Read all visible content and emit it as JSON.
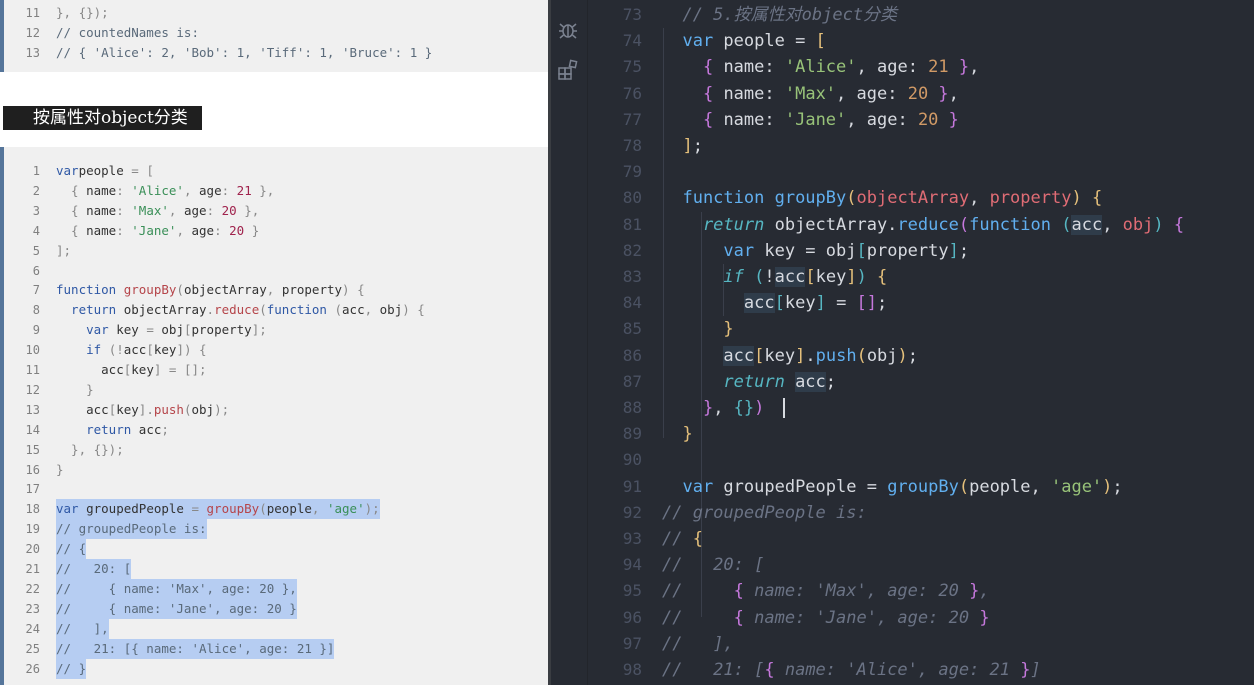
{
  "doc": {
    "heading": "按属性对object分类",
    "top_block": [
      {
        "n": "11",
        "tokens": [
          [
            "punc",
            "}, {});"
          ]
        ]
      },
      {
        "n": "12",
        "tokens": [
          [
            "cmt",
            "// countedNames is:"
          ]
        ]
      },
      {
        "n": "13",
        "tokens": [
          [
            "cmt",
            "// { 'Alice': 2, 'Bob': 1, 'Tiff': 1, 'Bruce': 1 }"
          ]
        ]
      }
    ],
    "main_block": [
      {
        "n": "1",
        "tokens": [
          [
            "kw",
            "var"
          ],
          [
            "",
            "people "
          ],
          [
            "punc",
            "= ["
          ]
        ]
      },
      {
        "n": "2",
        "tokens": [
          [
            "punc",
            "  { "
          ],
          [
            "",
            "name"
          ],
          [
            "punc",
            ": "
          ],
          [
            "str",
            "'Alice'"
          ],
          [
            "punc",
            ", "
          ],
          [
            "",
            "age"
          ],
          [
            "punc",
            ": "
          ],
          [
            "num",
            "21"
          ],
          [
            "punc",
            " },"
          ]
        ]
      },
      {
        "n": "3",
        "tokens": [
          [
            "punc",
            "  { "
          ],
          [
            "",
            "name"
          ],
          [
            "punc",
            ": "
          ],
          [
            "str",
            "'Max'"
          ],
          [
            "punc",
            ", "
          ],
          [
            "",
            "age"
          ],
          [
            "punc",
            ": "
          ],
          [
            "num",
            "20"
          ],
          [
            "punc",
            " },"
          ]
        ]
      },
      {
        "n": "4",
        "tokens": [
          [
            "punc",
            "  { "
          ],
          [
            "",
            "name"
          ],
          [
            "punc",
            ": "
          ],
          [
            "str",
            "'Jane'"
          ],
          [
            "punc",
            ", "
          ],
          [
            "",
            "age"
          ],
          [
            "punc",
            ": "
          ],
          [
            "num",
            "20"
          ],
          [
            "punc",
            " }"
          ]
        ]
      },
      {
        "n": "5",
        "tokens": [
          [
            "punc",
            "];"
          ]
        ]
      },
      {
        "n": "6",
        "tokens": []
      },
      {
        "n": "7",
        "tokens": [
          [
            "kw",
            "function "
          ],
          [
            "fn",
            "groupBy"
          ],
          [
            "punc",
            "("
          ],
          [
            "",
            "objectArray"
          ],
          [
            "punc",
            ", "
          ],
          [
            "",
            "property"
          ],
          [
            "punc",
            ") {"
          ]
        ]
      },
      {
        "n": "8",
        "tokens": [
          [
            "kw",
            "  return "
          ],
          [
            "",
            "objectArray"
          ],
          [
            "punc",
            "."
          ],
          [
            "fn",
            "reduce"
          ],
          [
            "punc",
            "("
          ],
          [
            "kw",
            "function "
          ],
          [
            "punc",
            "("
          ],
          [
            "",
            "acc"
          ],
          [
            "punc",
            ", "
          ],
          [
            "",
            "obj"
          ],
          [
            "punc",
            ") {"
          ]
        ]
      },
      {
        "n": "9",
        "tokens": [
          [
            "kw",
            "    var "
          ],
          [
            "",
            "key "
          ],
          [
            "punc",
            "= "
          ],
          [
            "",
            "obj"
          ],
          [
            "punc",
            "["
          ],
          [
            "",
            "property"
          ],
          [
            "punc",
            "];"
          ]
        ]
      },
      {
        "n": "10",
        "tokens": [
          [
            "kw",
            "    if "
          ],
          [
            "punc",
            "(!"
          ],
          [
            "",
            "acc"
          ],
          [
            "punc",
            "["
          ],
          [
            "",
            "key"
          ],
          [
            "punc",
            "]) {"
          ]
        ]
      },
      {
        "n": "11",
        "tokens": [
          [
            "",
            "      acc"
          ],
          [
            "punc",
            "["
          ],
          [
            "",
            "key"
          ],
          [
            "punc",
            "] = [];"
          ]
        ]
      },
      {
        "n": "12",
        "tokens": [
          [
            "punc",
            "    }"
          ]
        ]
      },
      {
        "n": "13",
        "tokens": [
          [
            "",
            "    acc"
          ],
          [
            "punc",
            "["
          ],
          [
            "",
            "key"
          ],
          [
            "punc",
            "]."
          ],
          [
            "fn",
            "push"
          ],
          [
            "punc",
            "("
          ],
          [
            "",
            "obj"
          ],
          [
            "punc",
            ");"
          ]
        ]
      },
      {
        "n": "14",
        "tokens": [
          [
            "kw",
            "    return "
          ],
          [
            "",
            "acc"
          ],
          [
            "punc",
            ";"
          ]
        ]
      },
      {
        "n": "15",
        "tokens": [
          [
            "punc",
            "  }, {});"
          ]
        ]
      },
      {
        "n": "16",
        "tokens": [
          [
            "punc",
            "}"
          ]
        ]
      },
      {
        "n": "17",
        "tokens": []
      },
      {
        "n": "18",
        "sel": true,
        "tokens": [
          [
            "kw",
            "var "
          ],
          [
            "",
            "groupedPeople "
          ],
          [
            "punc",
            "= "
          ],
          [
            "fn",
            "groupBy"
          ],
          [
            "punc",
            "("
          ],
          [
            "",
            "people"
          ],
          [
            "punc",
            ", "
          ],
          [
            "str",
            "'age'"
          ],
          [
            "punc",
            ");"
          ]
        ]
      },
      {
        "n": "19",
        "sel": true,
        "tokens": [
          [
            "cmt",
            "// groupedPeople is:"
          ]
        ]
      },
      {
        "n": "20",
        "sel": true,
        "tokens": [
          [
            "cmt",
            "// {"
          ]
        ]
      },
      {
        "n": "21",
        "sel": true,
        "tokens": [
          [
            "cmt",
            "//   20: ["
          ]
        ]
      },
      {
        "n": "22",
        "sel": true,
        "tokens": [
          [
            "cmt",
            "//     { name: 'Max', age: 20 },"
          ]
        ]
      },
      {
        "n": "23",
        "sel": true,
        "tokens": [
          [
            "cmt",
            "//     { name: 'Jane', age: 20 }"
          ]
        ]
      },
      {
        "n": "24",
        "sel": true,
        "tokens": [
          [
            "cmt",
            "//   ],"
          ]
        ]
      },
      {
        "n": "25",
        "sel": true,
        "tokens": [
          [
            "cmt",
            "//   21: [{ name: 'Alice', age: 21 }]"
          ]
        ]
      },
      {
        "n": "26",
        "sel": true,
        "tokens": [
          [
            "cmt",
            "// }"
          ]
        ]
      }
    ]
  },
  "editor": {
    "activity_icons": [
      "debug-icon",
      "extensions-icon"
    ],
    "lines": [
      {
        "n": "73",
        "tokens": [
          [
            "ecmt",
            "  // 5.按属性对object分类"
          ]
        ]
      },
      {
        "n": "74",
        "tokens": [
          [
            "ekw",
            "  var "
          ],
          [
            "",
            "people = "
          ],
          [
            "eb1",
            "["
          ]
        ]
      },
      {
        "n": "75",
        "tokens": [
          [
            "",
            "    "
          ],
          [
            "eb2",
            "{ "
          ],
          [
            "",
            "name: "
          ],
          [
            "estr",
            "'Alice'"
          ],
          [
            "",
            ", age: "
          ],
          [
            "enum",
            "21"
          ],
          [
            "eb2",
            " }"
          ],
          [
            "",
            ","
          ]
        ]
      },
      {
        "n": "76",
        "tokens": [
          [
            "",
            "    "
          ],
          [
            "eb2",
            "{ "
          ],
          [
            "",
            "name: "
          ],
          [
            "estr",
            "'Max'"
          ],
          [
            "",
            ", age: "
          ],
          [
            "enum",
            "20"
          ],
          [
            "eb2",
            " }"
          ],
          [
            "",
            ","
          ]
        ]
      },
      {
        "n": "77",
        "tokens": [
          [
            "",
            "    "
          ],
          [
            "eb2",
            "{ "
          ],
          [
            "",
            "name: "
          ],
          [
            "estr",
            "'Jane'"
          ],
          [
            "",
            ", age: "
          ],
          [
            "enum",
            "20"
          ],
          [
            "eb2",
            " }"
          ]
        ]
      },
      {
        "n": "78",
        "tokens": [
          [
            "eb1",
            "  ]"
          ],
          [
            "",
            ";"
          ]
        ]
      },
      {
        "n": "79",
        "tokens": []
      },
      {
        "n": "80",
        "tokens": [
          [
            "ekw",
            "  function "
          ],
          [
            "efn",
            "groupBy"
          ],
          [
            "eb1",
            "("
          ],
          [
            "eprm",
            "objectArray"
          ],
          [
            "",
            ", "
          ],
          [
            "eprm",
            "property"
          ],
          [
            "eb1",
            ") {"
          ]
        ]
      },
      {
        "n": "81",
        "tokens": [
          [
            "eret",
            "    return "
          ],
          [
            "",
            "objectArray."
          ],
          [
            "efn",
            "reduce"
          ],
          [
            "eb2",
            "("
          ],
          [
            "ekw",
            "function "
          ],
          [
            "eb3",
            "("
          ],
          [
            "eacc",
            "acc"
          ],
          [
            "",
            ", "
          ],
          [
            "eprm",
            "obj"
          ],
          [
            "eb3",
            ")"
          ],
          [
            "eb2",
            " {"
          ]
        ]
      },
      {
        "n": "82",
        "tokens": [
          [
            "ekw",
            "      var "
          ],
          [
            "",
            "key = obj"
          ],
          [
            "eb3",
            "["
          ],
          [
            "",
            "property"
          ],
          [
            "eb3",
            "]"
          ],
          [
            "",
            ";"
          ]
        ]
      },
      {
        "n": "83",
        "tokens": [
          [
            "eret",
            "      if "
          ],
          [
            "eb3",
            "("
          ],
          [
            "",
            "!"
          ],
          [
            "eacc",
            "acc"
          ],
          [
            "eb1",
            "["
          ],
          [
            "",
            "key"
          ],
          [
            "eb1",
            "]"
          ],
          [
            "eb3",
            ") "
          ],
          [
            "eb1",
            "{"
          ]
        ]
      },
      {
        "n": "84",
        "tokens": [
          [
            "",
            "        "
          ],
          [
            "eacc",
            "acc"
          ],
          [
            "eb3",
            "["
          ],
          [
            "",
            "key"
          ],
          [
            "eb3",
            "]"
          ],
          [
            "",
            " = "
          ],
          [
            "eb2",
            "[]"
          ],
          [
            "",
            ";"
          ]
        ]
      },
      {
        "n": "85",
        "tokens": [
          [
            "eb1",
            "      }"
          ]
        ]
      },
      {
        "n": "86",
        "tokens": [
          [
            "",
            "      "
          ],
          [
            "eacc",
            "acc"
          ],
          [
            "eb1",
            "["
          ],
          [
            "",
            "key"
          ],
          [
            "eb1",
            "]"
          ],
          [
            "",
            "."
          ],
          [
            "efn",
            "push"
          ],
          [
            "eb1",
            "("
          ],
          [
            "",
            "obj"
          ],
          [
            "eb1",
            ")"
          ],
          [
            "",
            ";"
          ]
        ]
      },
      {
        "n": "87",
        "tokens": [
          [
            "eret",
            "      return "
          ],
          [
            "eacc",
            "acc"
          ],
          [
            "",
            ";"
          ]
        ]
      },
      {
        "n": "88",
        "tokens": [
          [
            "eb2",
            "    }"
          ],
          [
            "",
            ", "
          ],
          [
            "eb3",
            "{}"
          ],
          [
            "eb2",
            ")"
          ]
        ]
      },
      {
        "n": "89",
        "tokens": [
          [
            "eb1",
            "  }"
          ]
        ]
      },
      {
        "n": "90",
        "tokens": []
      },
      {
        "n": "91",
        "tokens": [
          [
            "ekw",
            "  var "
          ],
          [
            "",
            "groupedPeople = "
          ],
          [
            "efn",
            "groupBy"
          ],
          [
            "eb1",
            "("
          ],
          [
            "",
            "people, "
          ],
          [
            "estr",
            "'age'"
          ],
          [
            "eb1",
            ")"
          ],
          [
            "",
            ";"
          ]
        ]
      },
      {
        "n": "92",
        "tokens": [
          [
            "ecmt",
            "// groupedPeople is:"
          ]
        ]
      },
      {
        "n": "93",
        "tokens": [
          [
            "ecmt",
            "// "
          ],
          [
            "eb1",
            "{"
          ]
        ]
      },
      {
        "n": "94",
        "tokens": [
          [
            "ecmt",
            "//   20: ["
          ]
        ]
      },
      {
        "n": "95",
        "tokens": [
          [
            "ecmt",
            "//     "
          ],
          [
            "eb2",
            "{"
          ],
          [
            "ecmt",
            " name: 'Max', age: 20 "
          ],
          [
            "eb2",
            "}"
          ],
          [
            "ecmt",
            ","
          ]
        ]
      },
      {
        "n": "96",
        "tokens": [
          [
            "ecmt",
            "//     "
          ],
          [
            "eb2",
            "{"
          ],
          [
            "ecmt",
            " name: 'Jane', age: 20 "
          ],
          [
            "eb2",
            "}"
          ]
        ]
      },
      {
        "n": "97",
        "tokens": [
          [
            "ecmt",
            "//   ],"
          ]
        ]
      },
      {
        "n": "98",
        "tokens": [
          [
            "ecmt",
            "//   21: ["
          ],
          [
            "eb2",
            "{"
          ],
          [
            "ecmt",
            " name: 'Alice', age: 21 "
          ],
          [
            "eb2",
            "}"
          ],
          [
            "ecmt",
            "]"
          ]
        ]
      }
    ]
  }
}
